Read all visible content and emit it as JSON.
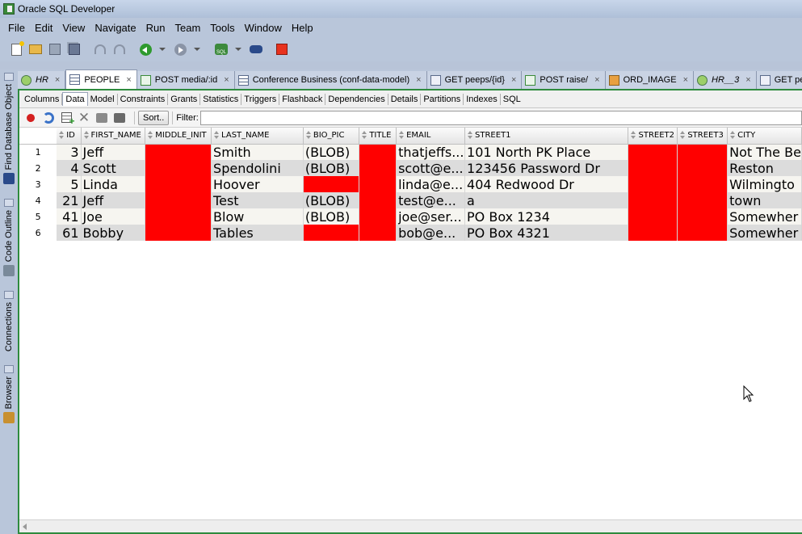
{
  "window": {
    "title": "Oracle SQL Developer"
  },
  "menu": [
    "File",
    "Edit",
    "View",
    "Navigate",
    "Run",
    "Team",
    "Tools",
    "Window",
    "Help"
  ],
  "toolbar": {
    "icons": [
      "new-icon",
      "open-icon",
      "save-icon",
      "save-all-icon",
      "undo-icon",
      "redo-icon",
      "back-icon",
      "forward-icon",
      "sql-worksheet-icon",
      "find-db-object-icon",
      "stop-icon"
    ]
  },
  "left_dock": [
    "Find Database Object",
    "Code Outline",
    "Connections",
    "Browser"
  ],
  "editor_tabs": [
    {
      "label": "HR",
      "icon": "hr-connection-icon",
      "italic": true
    },
    {
      "label": "PEOPLE",
      "icon": "table-icon",
      "active": true
    },
    {
      "label": "POST media/:id",
      "icon": "rest-post-icon"
    },
    {
      "label": "Conference Business (conf-data-model)",
      "icon": "data-model-icon"
    },
    {
      "label": "GET peeps/{id}",
      "icon": "rest-get-icon"
    },
    {
      "label": "POST raise/",
      "icon": "rest-post-icon"
    },
    {
      "label": "ORD_IMAGE",
      "icon": "object-type-icon"
    },
    {
      "label": "HR__3",
      "icon": "hr-connection-icon",
      "italic": true
    },
    {
      "label": "GET peep",
      "icon": "rest-get-icon"
    }
  ],
  "sub_tabs": [
    "Columns",
    "Data",
    "Model",
    "Constraints",
    "Grants",
    "Statistics",
    "Triggers",
    "Flashback",
    "Dependencies",
    "Details",
    "Partitions",
    "Indexes",
    "SQL"
  ],
  "active_sub_tab": "Data",
  "data_toolbar": {
    "sort_label": "Sort..",
    "filter_label": "Filter:",
    "filter_value": ""
  },
  "grid": {
    "columns": [
      "ID",
      "FIRST_NAME",
      "MIDDLE_INIT",
      "LAST_NAME",
      "BIO_PIC",
      "TITLE",
      "EMAIL",
      "STREET1",
      "STREET2",
      "STREET3",
      "CITY"
    ],
    "null_color": "#ff0000",
    "rows": [
      [
        "1",
        "3",
        "Jeff",
        null,
        "Smith",
        "(BLOB)",
        null,
        "thatjeffs...",
        "101 North PK Place",
        null,
        null,
        "Not The Be"
      ],
      [
        "2",
        "4",
        "Scott",
        null,
        "Spendolini",
        "(BLOB)",
        null,
        "scott@e...",
        "123456 Password Dr",
        null,
        null,
        "Reston"
      ],
      [
        "3",
        "5",
        "Linda",
        null,
        "Hoover",
        null,
        null,
        "linda@e...",
        "404 Redwood Dr",
        null,
        null,
        "Wilmingto"
      ],
      [
        "4",
        "21",
        "Jeff",
        null,
        "Test",
        "(BLOB)",
        null,
        "test@e...",
        "a",
        null,
        null,
        "town"
      ],
      [
        "5",
        "41",
        "Joe",
        null,
        "Blow",
        "(BLOB)",
        null,
        "joe@ser...",
        "PO Box 1234",
        null,
        null,
        "Somewher"
      ],
      [
        "6",
        "61",
        "Bobby",
        null,
        "Tables",
        null,
        null,
        "bob@e...",
        "PO Box 4321",
        null,
        null,
        "Somewher"
      ]
    ]
  },
  "colors": {
    "panel_border": "#2e8b3e",
    "row_odd": "#f6f5f0",
    "row_even": "#dcdcdc",
    "chrome": "#b9c6da"
  }
}
